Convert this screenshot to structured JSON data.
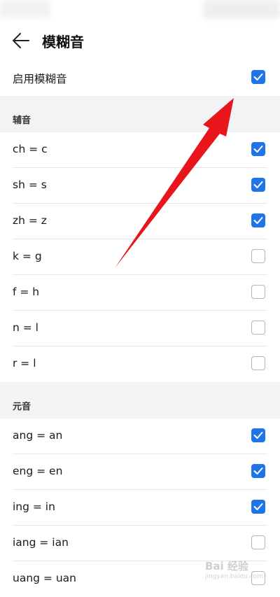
{
  "header": {
    "title": "模糊音"
  },
  "enable": {
    "label": "启用模糊音",
    "checked": true
  },
  "sections": [
    {
      "title": "辅音",
      "items": [
        {
          "label": "ch = c",
          "checked": true
        },
        {
          "label": "sh = s",
          "checked": true
        },
        {
          "label": "zh = z",
          "checked": true
        },
        {
          "label": "k = g",
          "checked": false
        },
        {
          "label": "f = h",
          "checked": false
        },
        {
          "label": "n = l",
          "checked": false
        },
        {
          "label": "r = l",
          "checked": false
        }
      ]
    },
    {
      "title": "元音",
      "items": [
        {
          "label": "ang = an",
          "checked": true
        },
        {
          "label": "eng = en",
          "checked": true
        },
        {
          "label": "ing = in",
          "checked": true
        },
        {
          "label": "iang = ian",
          "checked": false
        },
        {
          "label": "uang = uan",
          "checked": false
        }
      ]
    }
  ],
  "colors": {
    "accent": "#1e74e8",
    "annotation_arrow": "#e8161c"
  },
  "watermark": {
    "text": "Bai 经验",
    "sub": "jingyan.baidu.com"
  }
}
